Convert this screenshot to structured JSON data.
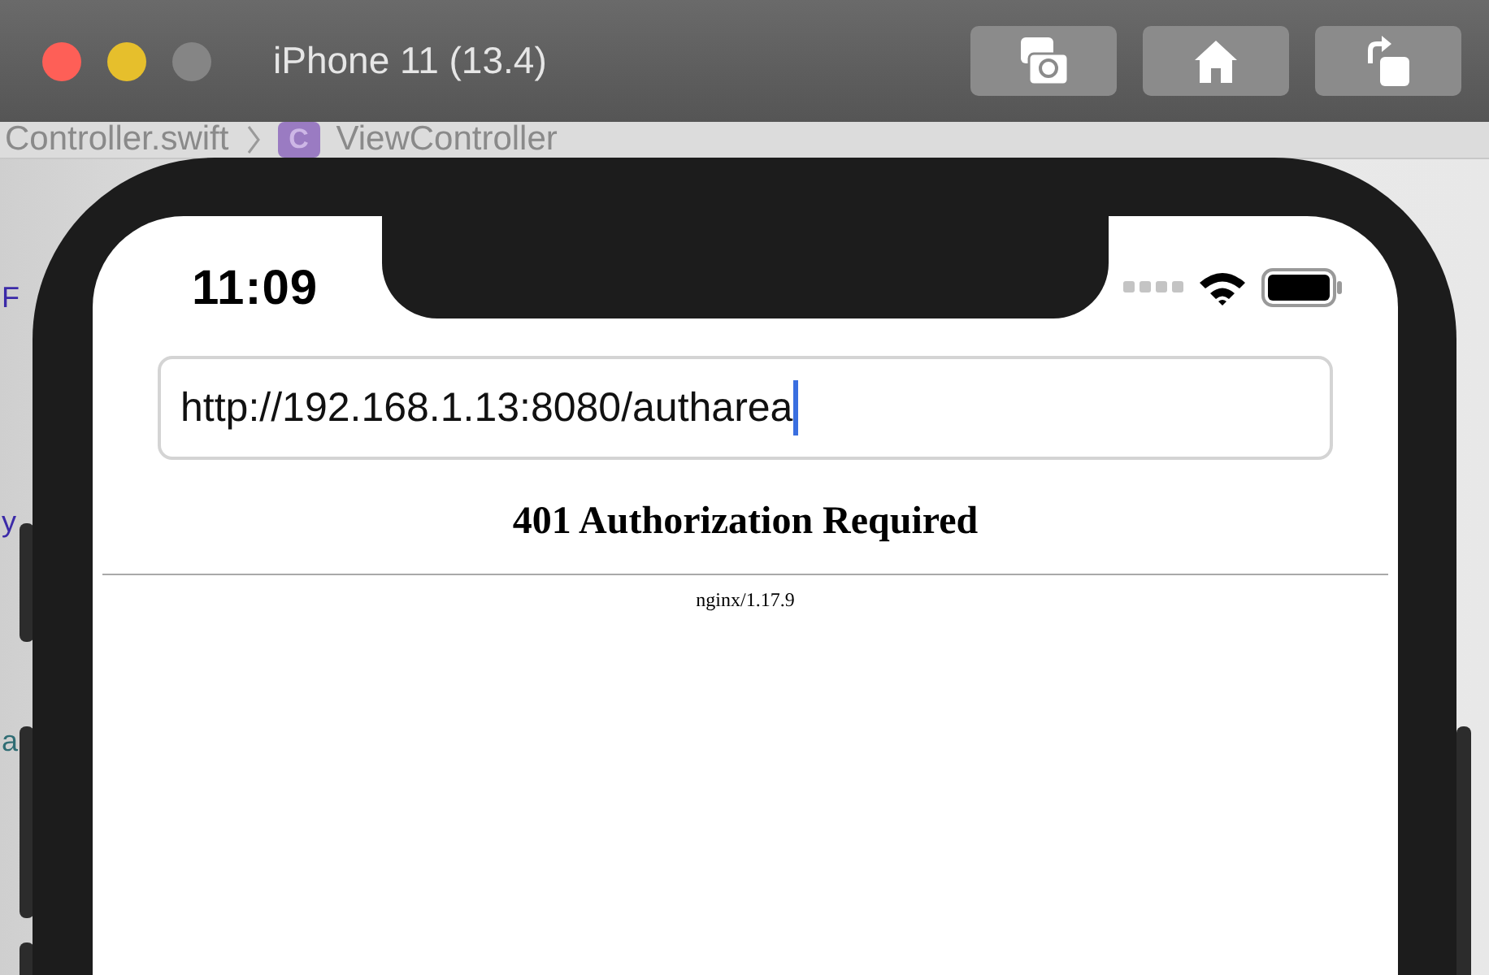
{
  "window": {
    "title": "iPhone 11 (13.4)",
    "controls": [
      {
        "kind": "close",
        "disabled": false
      },
      {
        "kind": "minimize",
        "disabled": false
      },
      {
        "kind": "zoom",
        "disabled": true
      }
    ],
    "toolbar_buttons": [
      {
        "kind": "screenshot"
      },
      {
        "kind": "home"
      },
      {
        "kind": "rotate"
      }
    ]
  },
  "editor": {
    "breadcrumb": [
      {
        "kind": "file",
        "label": "Controller.swift"
      },
      {
        "kind": "class",
        "badge": "C",
        "label": "ViewController"
      }
    ],
    "code_fragments": [
      {
        "text": "F",
        "color": "#3b2aa8"
      },
      {
        "text": "y",
        "color": "#3b2aa8"
      },
      {
        "text": "a",
        "color": "#2f6d74"
      }
    ]
  },
  "device": {
    "status_bar": {
      "time": "11:09"
    },
    "address_field": {
      "value": "http://192.168.1.13:8080/autharea",
      "focused": true
    },
    "page": {
      "heading": "401 Authorization Required",
      "footer": "nginx/1.17.9"
    }
  }
}
